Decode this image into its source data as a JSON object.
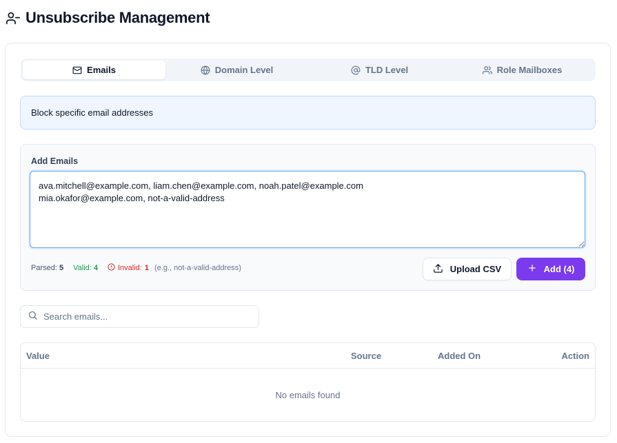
{
  "header": {
    "title": "Unsubscribe Management",
    "icon": "user-minus-icon"
  },
  "tabs": [
    {
      "label": "Emails",
      "icon": "mail-icon",
      "active": true
    },
    {
      "label": "Domain Level",
      "icon": "globe-icon",
      "active": false
    },
    {
      "label": "TLD Level",
      "icon": "at-sign-icon",
      "active": false
    },
    {
      "label": "Role Mailboxes",
      "icon": "users-icon",
      "active": false
    }
  ],
  "info": {
    "text": "Block specific email addresses"
  },
  "add_panel": {
    "label": "Add Emails",
    "textarea_value": "ava.mitchell@example.com, liam.chen@example.com, noah.patel@example.com\nmia.okafor@example.com, not-a-valid-address",
    "stats": {
      "parsed_label": "Parsed:",
      "parsed_count": "5",
      "valid_label": "Valid:",
      "valid_count": "4",
      "invalid_label": "Invalid:",
      "invalid_count": "1",
      "invalid_example": "(e.g., not-a-valid-address)"
    },
    "upload_button": "Upload CSV",
    "add_button": "Add (4)"
  },
  "search": {
    "placeholder": "Search emails..."
  },
  "table": {
    "columns": [
      "Value",
      "Source",
      "Added On",
      "Action"
    ],
    "rows": [],
    "empty_text": "No emails found"
  },
  "colors": {
    "accent": "#7c3aed",
    "valid": "#16a34a",
    "invalid": "#dc2626",
    "info_bg": "#eff6ff",
    "info_border": "#bfdbfe"
  }
}
